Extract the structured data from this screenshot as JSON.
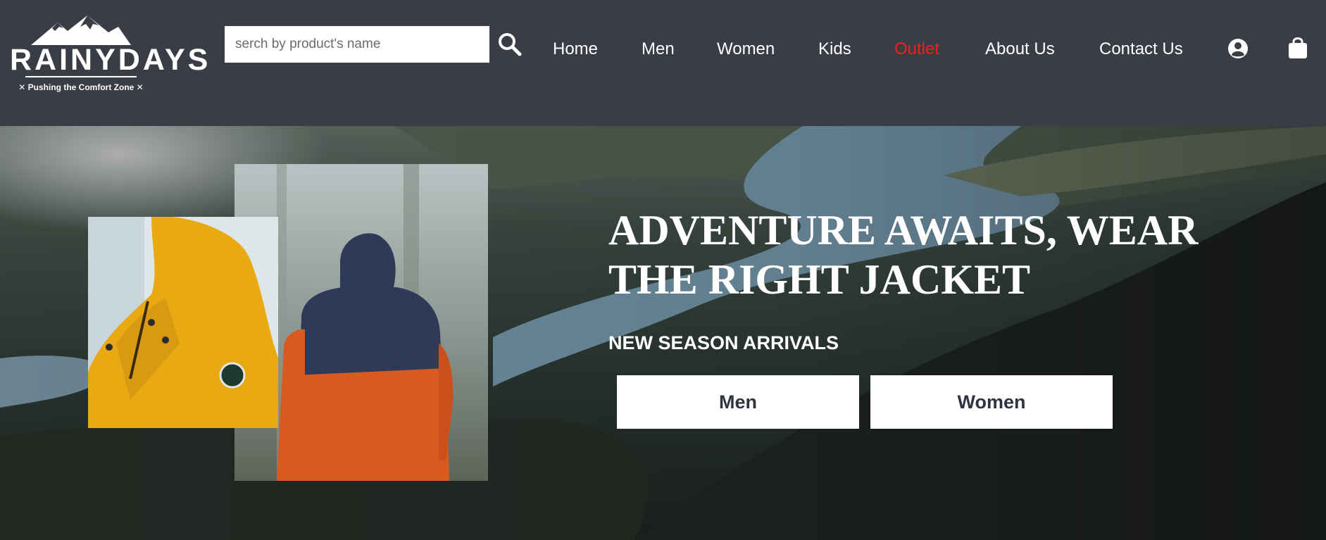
{
  "brand": {
    "name": "RAINYDAYS",
    "tagline": "✕ Pushing the Comfort Zone ✕"
  },
  "search": {
    "placeholder": "serch by product's name",
    "value": ""
  },
  "nav": {
    "items": [
      {
        "label": "Home"
      },
      {
        "label": "Men"
      },
      {
        "label": "Women"
      },
      {
        "label": "Kids"
      },
      {
        "label": "Outlet",
        "color": "#ff1a1a"
      },
      {
        "label": "About Us"
      },
      {
        "label": "Contact Us"
      }
    ]
  },
  "icons": {
    "search": "search-icon",
    "account": "user-circle-icon",
    "cart": "shopping-bag-icon"
  },
  "hero": {
    "title_line1": "ADVENTURE AWAITS, WEAR",
    "title_line2": "THE RIGHT JACKET",
    "subtitle": "NEW SEASON ARRIVALS",
    "buttons": [
      {
        "label": "Men"
      },
      {
        "label": "Women"
      }
    ]
  },
  "colors": {
    "header_bg": "#3a3d45",
    "accent_outlet": "#ff1a1a",
    "button_text": "#2f3440"
  }
}
